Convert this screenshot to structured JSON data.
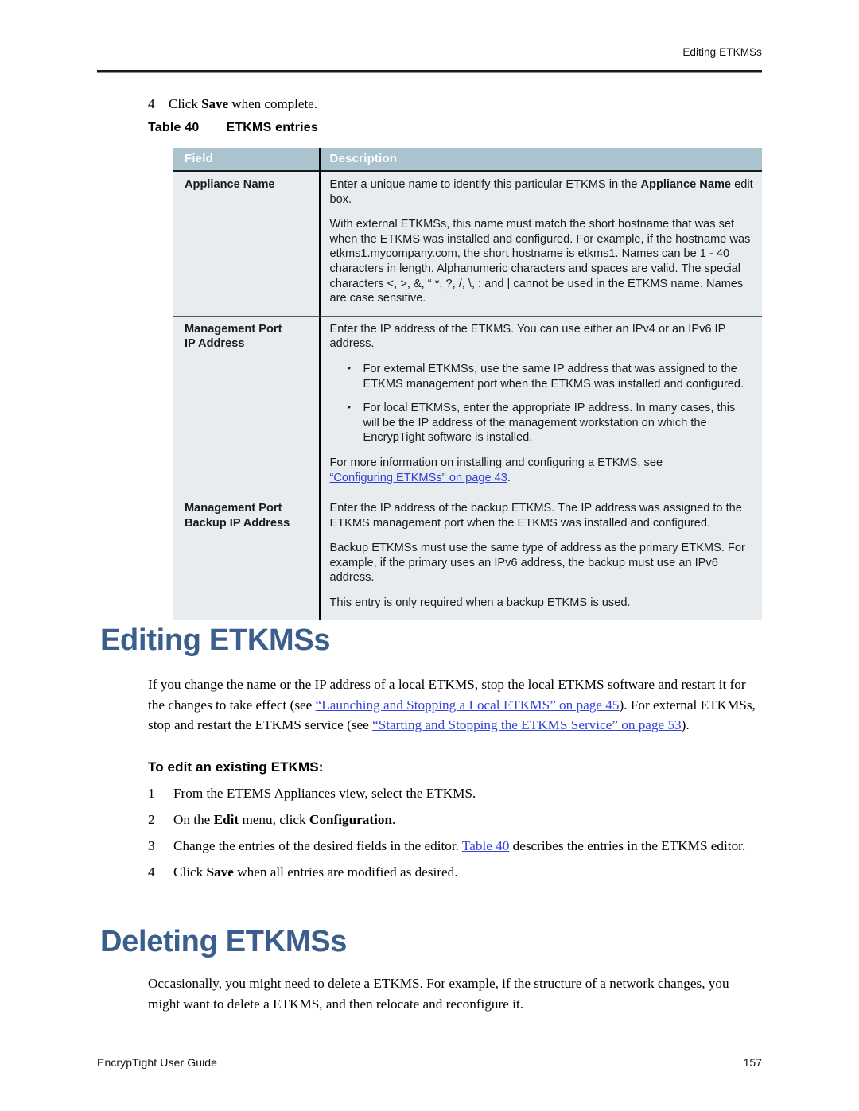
{
  "running_header": {
    "text": "Editing ETKMSs"
  },
  "pre_step": {
    "number": "4",
    "text_before": "Click ",
    "bold": "Save",
    "text_after": " when complete."
  },
  "table_caption": {
    "number": "Table 40",
    "title": "ETKMS entries"
  },
  "table": {
    "columns": [
      "Field",
      "Description"
    ],
    "header_bg": "#aac3cf",
    "cell_bg": "#e9ecee",
    "rows": [
      {
        "field": "Appliance Name",
        "paragraphs": [
          "Enter a unique name to identify this particular ETKMS in the Appliance Name edit box.",
          "With external ETKMSs, this name must match the short hostname that was set when the ETKMS was installed and configured. For example, if the hostname was etkms1.mycompany.com, the short hostname is etkms1. Names can be 1 - 40 characters in length. Alphanumeric characters and spaces are valid. The special characters <, >, &, “ *, ?, /, \\, : and | cannot be used in the ETKMS name. Names are case sensitive."
        ],
        "bullets": [],
        "closing": "",
        "link": ""
      },
      {
        "field": "Management Port IP Address",
        "field_line1": "Management Port",
        "field_line2": "IP Address",
        "paragraphs": [
          "Enter the IP address of the ETKMS. You can use either an IPv4 or an IPv6 IP address."
        ],
        "bullets": [
          "For external ETKMSs, use the same IP address that was assigned to the ETKMS management port when the ETKMS was installed and configured.",
          "For local ETKMSs, enter the appropriate IP address. In many cases, this will be the IP address of the management workstation on which the EncrypTight software is installed."
        ],
        "closing": "For more information on installing and configuring a ETKMS, see",
        "link": "“Configuring ETKMSs\" on page 43",
        "link_suffix": "."
      },
      {
        "field": "Management Port Backup IP Address",
        "field_line1": "Management Port",
        "field_line2": "Backup IP Address",
        "paragraphs": [
          "Enter the IP address of the backup ETKMS. The IP address was assigned to the ETKMS management port when the ETKMS was installed and configured.",
          "Backup ETKMSs must use the same type of address as the primary ETKMS. For example, if the primary uses an IPv6 address, the backup must use an IPv6 address.",
          "This entry is only required when a backup ETKMS is used."
        ],
        "bullets": [],
        "closing": "",
        "link": ""
      }
    ]
  },
  "section_editing": {
    "heading": "Editing ETKMSs",
    "heading_color": "#3a5f8c",
    "paragraph": {
      "p1": "If you change the name or the IP address of a local ETKMS, stop the local ETKMS software and restart it for the changes to take effect (see ",
      "link1": "“Launching and Stopping a Local ETKMS” on page 45",
      "p2": "). For external ETKMSs, stop and restart the ETKMS service (see ",
      "link2": "“Starting and Stopping the ETKMS Service” on page 53",
      "p3": ")."
    },
    "subheading": "To edit an existing ETKMS:",
    "steps": [
      {
        "n": "1",
        "a": "From the ETEMS Appliances view, select the ETKMS.",
        "b": "",
        "c": ""
      },
      {
        "n": "2",
        "a": "On the ",
        "b": "Edit",
        "c": " menu, click ",
        "d": "Configuration",
        "e": "."
      },
      {
        "n": "3",
        "a": "Change the entries of the desired fields in the editor. ",
        "link": "Table 40",
        "c": " describes the entries in the ETKMS editor."
      },
      {
        "n": "4",
        "a": "Click ",
        "b": "Save",
        "c": " when all entries are modified as desired."
      }
    ]
  },
  "section_deleting": {
    "heading": "Deleting ETKMSs",
    "paragraph": "Occasionally, you might need to delete a ETKMS. For example, if the structure of a network changes, you might want to delete a ETKMS, and then relocate and reconfigure it."
  },
  "footer": {
    "left": "EncrypTight User Guide",
    "right": "157"
  },
  "colors": {
    "link": "#3344dd",
    "heading": "#3a5f8c",
    "table_header_bg": "#aac3cf",
    "table_cell_bg": "#e9ecee"
  }
}
